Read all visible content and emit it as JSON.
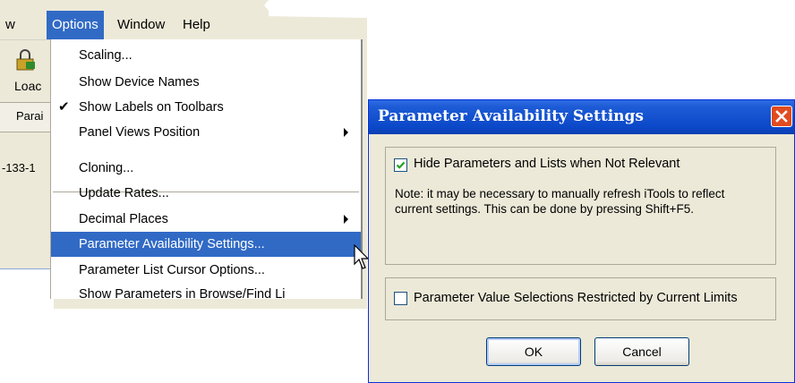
{
  "menubar": {
    "items": [
      {
        "label": "w"
      },
      {
        "label": "Options"
      },
      {
        "label": "Window"
      },
      {
        "label": "Help"
      }
    ]
  },
  "toolbar": {
    "load_label": "Loac"
  },
  "tab": {
    "label": "Parai"
  },
  "row": {
    "label": "-133-1"
  },
  "options_menu": {
    "items": [
      {
        "label": "Scaling..."
      },
      {
        "label": "Show Device Names"
      },
      {
        "label": "Show Labels on Toolbars",
        "checked": true
      },
      {
        "label": "Panel Views Position",
        "submenu": true
      },
      {
        "label": "Cloning..."
      },
      {
        "label": "Update Rates..."
      },
      {
        "label": "Decimal Places",
        "submenu": true
      },
      {
        "label": "Parameter Availability Settings...",
        "highlighted": true
      },
      {
        "label": "Parameter List Cursor Options..."
      },
      {
        "label": "Show Parameters in Browse/Find Li"
      }
    ],
    "check_glyph": "✔"
  },
  "dialog": {
    "title": "Parameter Availability Settings",
    "hide_params": {
      "label": "Hide Parameters and Lists when Not Relevant",
      "checked": true
    },
    "note": "Note:  it may be necessary to manually refresh iTools to reflect current settings.  This can be done by pressing Shift+F5.",
    "restrict_values": {
      "label": "Parameter Value Selections Restricted by Current Limits",
      "checked": false
    },
    "ok_label": "OK",
    "cancel_label": "Cancel"
  },
  "colors": {
    "highlight": "#316ac5",
    "titlebar": "#0b48c8",
    "close": "#e14b1f",
    "dialog_bg": "#ece9d8"
  }
}
